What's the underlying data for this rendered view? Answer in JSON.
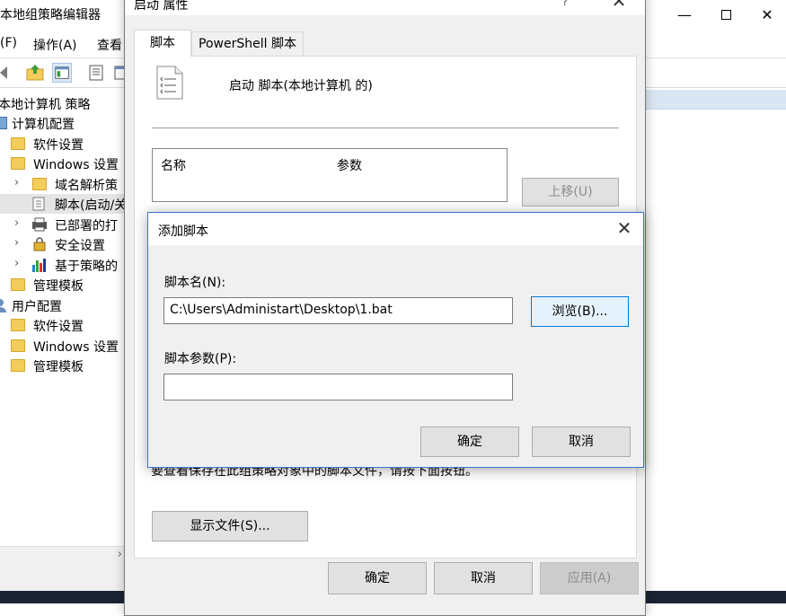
{
  "gpedit": {
    "title": "本地组策略编辑器",
    "window_controls": {
      "minimize": "—",
      "close": "✕"
    },
    "menu": {
      "file": "(F)",
      "action": "操作(A)",
      "view": "查看"
    },
    "tree": [
      {
        "label": "本地计算机 策略",
        "icon": "computer-policy-icon"
      },
      {
        "label": "计算机配置",
        "icon": "computer-icon",
        "expander": "⌄"
      },
      {
        "label": "软件设置",
        "icon": "folder-icon"
      },
      {
        "label": "Windows 设置",
        "icon": "folder-icon",
        "expander": "⌄"
      },
      {
        "label": "域名解析策",
        "icon": "folder-icon",
        "expander": "›"
      },
      {
        "label": "脚本(启动/关",
        "icon": "script-icon"
      },
      {
        "label": "已部署的打",
        "icon": "printer-icon",
        "expander": "›"
      },
      {
        "label": "安全设置",
        "icon": "security-icon",
        "expander": "›"
      },
      {
        "label": "基于策略的",
        "icon": "chart-icon",
        "expander": "›"
      },
      {
        "label": "管理模板",
        "icon": "folder-icon"
      },
      {
        "label": "用户配置",
        "icon": "user-icon",
        "expander": "⌄"
      },
      {
        "label": "软件设置",
        "icon": "folder-icon"
      },
      {
        "label": "Windows 设置",
        "icon": "folder-icon"
      },
      {
        "label": "管理模板",
        "icon": "folder-icon"
      }
    ],
    "scroll_arrow": "›"
  },
  "props": {
    "title": "启动 属性",
    "help": "?",
    "close": "✕",
    "tabs": {
      "scripts": "脚本",
      "powershell": "PowerShell 脚本"
    },
    "heading": "启动 脚本(本地计算机 的)",
    "list_columns": {
      "name": "名称",
      "params": "参数"
    },
    "up_button": "上移(U)",
    "info": "要查看保存在此组策略对象中的脚本文件，请按下面按钮。",
    "show_files": "显示文件(S)...",
    "ok": "确定",
    "cancel": "取消",
    "apply": "应用(A)"
  },
  "addscript": {
    "title": "添加脚本",
    "close": "✕",
    "name_label": "脚本名(N):",
    "name_value": "C:\\Users\\Administart\\Desktop\\1.bat",
    "browse": "浏览(B)...",
    "params_label": "脚本参数(P):",
    "params_value": "",
    "ok": "确定",
    "cancel": "取消"
  },
  "colors": {
    "dialog_bg": "#f0f0f0",
    "accent_border": "#0078d7",
    "button_bg": "#e1e1e1",
    "tree_header": "#dbe6f4"
  }
}
